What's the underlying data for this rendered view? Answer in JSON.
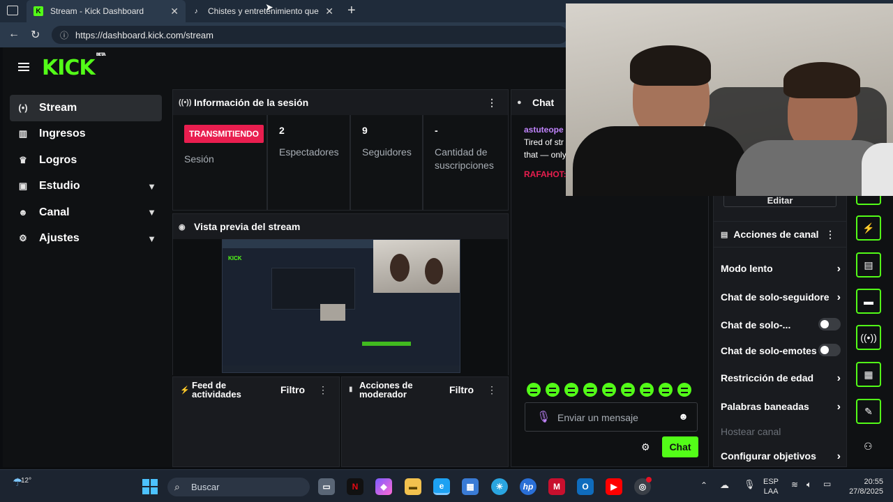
{
  "browser": {
    "tabs": [
      {
        "title": "Stream - Kick Dashboard",
        "active": true
      },
      {
        "title": "Chistes y entretenimiento que te",
        "active": false
      }
    ],
    "url": "https://dashboard.kick.com/stream"
  },
  "brand": {
    "logo": "KICK",
    "beta": "BETA",
    "accent": "#53fc18"
  },
  "sidebar": {
    "items": [
      {
        "label": "Stream",
        "icon": "broadcast-icon",
        "active": true
      },
      {
        "label": "Ingresos",
        "icon": "chart-icon"
      },
      {
        "label": "Logros",
        "icon": "trophy-icon"
      },
      {
        "label": "Estudio",
        "icon": "studio-icon",
        "expandable": true
      },
      {
        "label": "Canal",
        "icon": "users-icon",
        "expandable": true
      },
      {
        "label": "Ajustes",
        "icon": "gear-icon",
        "expandable": true
      }
    ]
  },
  "session": {
    "title": "Información de la sesión",
    "badge": "TRANSMITIENDO",
    "badge_label": "Sesión",
    "stats": [
      {
        "value": "2",
        "label": "Espectadores"
      },
      {
        "value": "9",
        "label": "Seguidores"
      },
      {
        "value": "-",
        "label": "Cantidad de suscripciones"
      }
    ]
  },
  "preview": {
    "title": "Vista previa del stream"
  },
  "activity": {
    "title": "Feed de actividades",
    "filter": "Filtro"
  },
  "moderator": {
    "title": "Acciones de moderador",
    "filter": "Filtro"
  },
  "chat": {
    "title": "Chat",
    "messages": [
      {
        "user": "astuteope",
        "user_color": "#c084fc",
        "text_lines": [
          "Tired of str",
          "that — only"
        ]
      },
      {
        "user": "RAFAHOT:",
        "user_color": "#e91e4f",
        "text_lines": []
      }
    ],
    "input_placeholder": "Enviar un mensaje",
    "send_label": "Chat"
  },
  "channel_actions": {
    "edit_label": "Editar",
    "title": "Acciones de canal",
    "items": [
      {
        "label": "Modo lento",
        "kind": "arrow"
      },
      {
        "label": "Chat de solo-seguidore",
        "kind": "arrow"
      },
      {
        "label": "Chat de solo-...",
        "kind": "toggle"
      },
      {
        "label": "Chat de solo-emotes",
        "kind": "toggle"
      },
      {
        "label": "Restricción de edad",
        "kind": "arrow"
      },
      {
        "label": "Palabras baneadas",
        "kind": "arrow"
      },
      {
        "label": "Hostear canal",
        "kind": "disabled"
      },
      {
        "label": "Configurar objetivos",
        "kind": "arrow"
      }
    ]
  },
  "taskbar": {
    "weather": "12°",
    "search_placeholder": "Buscar",
    "lang_top": "ESP",
    "lang_bottom": "LAA",
    "time": "20:55",
    "date": "27/8/2025"
  }
}
